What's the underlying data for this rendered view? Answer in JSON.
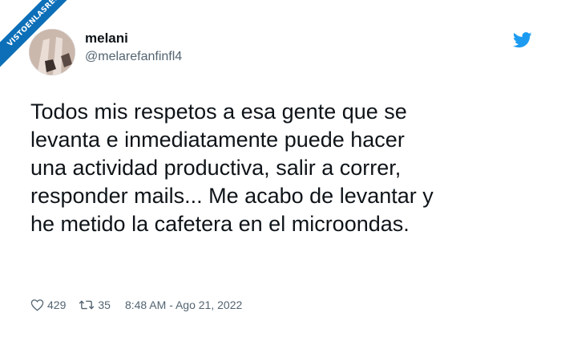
{
  "watermark": {
    "text": "VISTOENLASREDES",
    "color": "#0c6fb8"
  },
  "tweet": {
    "author_name": "melani",
    "author_handle": "@melarefanfinfl4",
    "text_lines": [
      "Todos mis respetos a esa gente que se",
      "levanta e inmediatamente puede hacer",
      "una actividad productiva, salir a correr,",
      "responder mails... Me acabo de levantar y",
      "he metido la cafetera en el microondas."
    ],
    "likes": "429",
    "retweets": "35",
    "timestamp": "8:48 AM - Ago 21, 2022"
  },
  "icons": {
    "logo": "twitter-bird-icon",
    "likes": "heart-icon",
    "retweets": "retweet-icon"
  },
  "colors": {
    "brand": "#1d9bf0",
    "text": "#0f1419",
    "secondary": "#536471"
  }
}
